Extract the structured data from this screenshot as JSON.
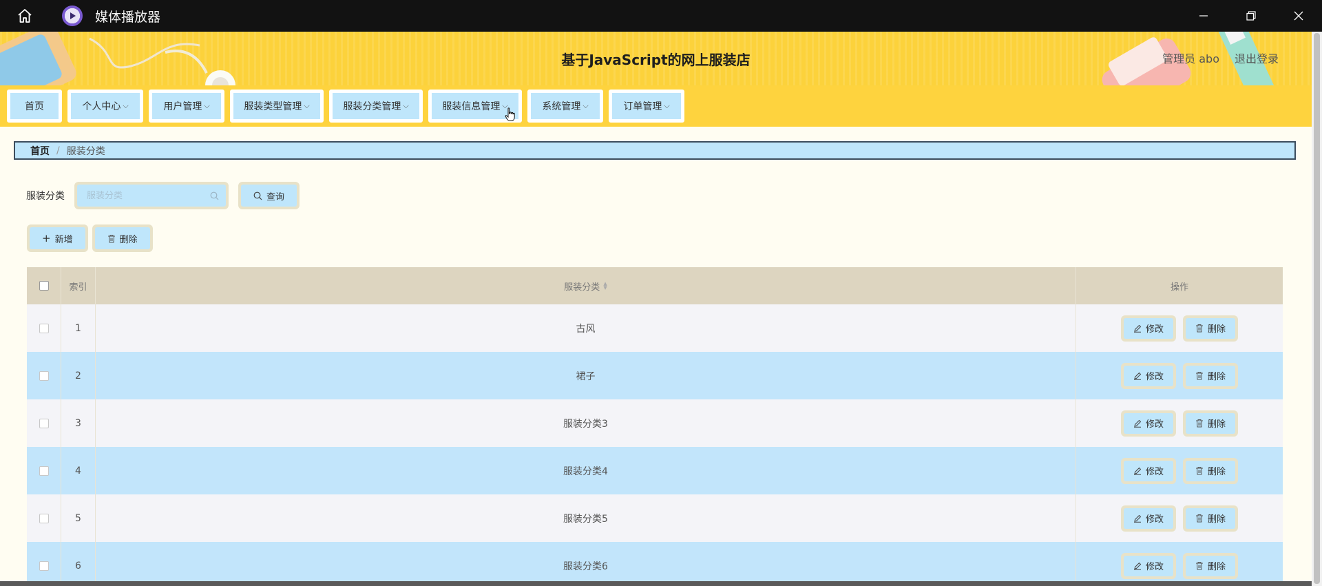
{
  "window": {
    "title": "媒体播放器",
    "home_icon": "home-icon",
    "app_icon": "media-player-icon",
    "controls": [
      "minimize-icon",
      "restore-icon",
      "close-icon"
    ]
  },
  "header": {
    "site_title": "基于JavaScript的网上服装店",
    "user_label": "管理员 abo",
    "logout_label": "退出登录"
  },
  "nav": {
    "items": [
      {
        "label": "首页",
        "dropdown": false
      },
      {
        "label": "个人中心",
        "dropdown": true
      },
      {
        "label": "用户管理",
        "dropdown": true
      },
      {
        "label": "服装类型管理",
        "dropdown": true
      },
      {
        "label": "服装分类管理",
        "dropdown": true
      },
      {
        "label": "服装信息管理",
        "dropdown": true
      },
      {
        "label": "系统管理",
        "dropdown": true
      },
      {
        "label": "订单管理",
        "dropdown": true
      }
    ]
  },
  "breadcrumb": {
    "home": "首页",
    "separator": "/",
    "current": "服装分类"
  },
  "search": {
    "label": "服装分类",
    "placeholder": "服装分类",
    "value": "",
    "query_button": "查询"
  },
  "actions": {
    "add_button": "新增",
    "delete_button": "删除"
  },
  "table": {
    "headers": {
      "index": "索引",
      "name": "服装分类",
      "operation": "操作"
    },
    "edit_label": "修改",
    "delete_label": "删除",
    "rows": [
      {
        "index": "1",
        "name": "古风"
      },
      {
        "index": "2",
        "name": "裙子"
      },
      {
        "index": "3",
        "name": "服装分类3"
      },
      {
        "index": "4",
        "name": "服装分类4"
      },
      {
        "index": "5",
        "name": "服装分类5"
      },
      {
        "index": "6",
        "name": "服装分类6"
      }
    ]
  },
  "colors": {
    "header_yellow": "#fcd23b",
    "button_blue": "#bfe6fb",
    "button_frame": "#e8e2c8",
    "table_header": "#ddd5c0",
    "row_alt": "#c2e5fb",
    "page_bg": "#fffdf2"
  }
}
